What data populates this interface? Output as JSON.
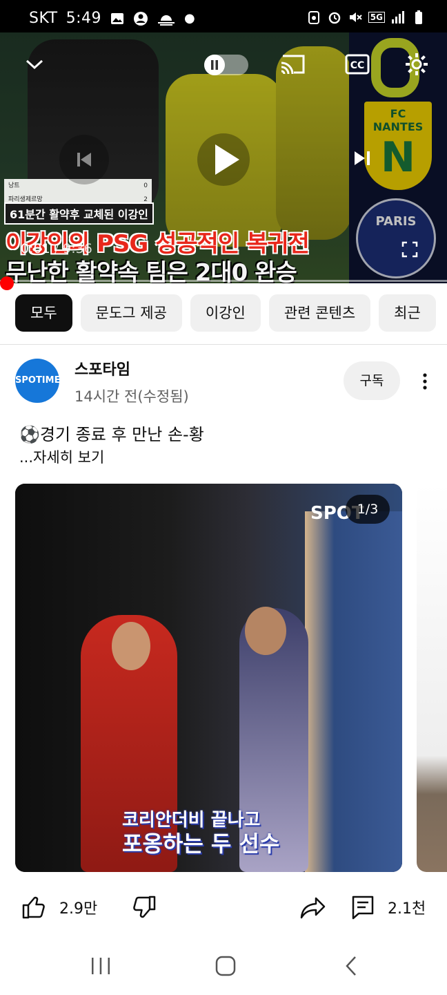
{
  "status_bar": {
    "carrier": "SKT",
    "time": "5:49",
    "network": "5G"
  },
  "player": {
    "thumbnail": {
      "score_rows": [
        {
          "team": "낭트",
          "score": "0"
        },
        {
          "team": "파리생제르망",
          "score": "2"
        }
      ],
      "subtitle_box": "61분간 활약후 교체된 이강인",
      "headline_line1": "이강인의 PSG 성공적인 복귀전",
      "headline_line2": "무난한 활약속 팀은 2대0 완승",
      "badge_nantes": "FC NANTES",
      "badge_psg": "PARIS"
    },
    "time_current": "0:01",
    "time_separator": " / ",
    "time_total": "9:36",
    "progress_fraction": 0.002
  },
  "chips": [
    {
      "label": "모두",
      "active": true
    },
    {
      "label": "문도그 제공",
      "active": false
    },
    {
      "label": "이강인",
      "active": false
    },
    {
      "label": "관련 콘텐츠",
      "active": false
    },
    {
      "label": "최근",
      "active": false
    }
  ],
  "post": {
    "channel_avatar_text": "SPOTIME",
    "channel_name": "스포타임",
    "meta": "14시간 전(수정됨)",
    "subscribe_label": "구독",
    "text": "⚽경기 종료 후 만난 손-황",
    "more_label": "...자세히 보기",
    "image": {
      "watermark": "SPOT",
      "counter": "1/3",
      "caption_line1": "코리안더비 끝나고",
      "caption_line2": "포옹하는 두 선수"
    },
    "likes": "2.9만",
    "comments": "2.1천"
  }
}
